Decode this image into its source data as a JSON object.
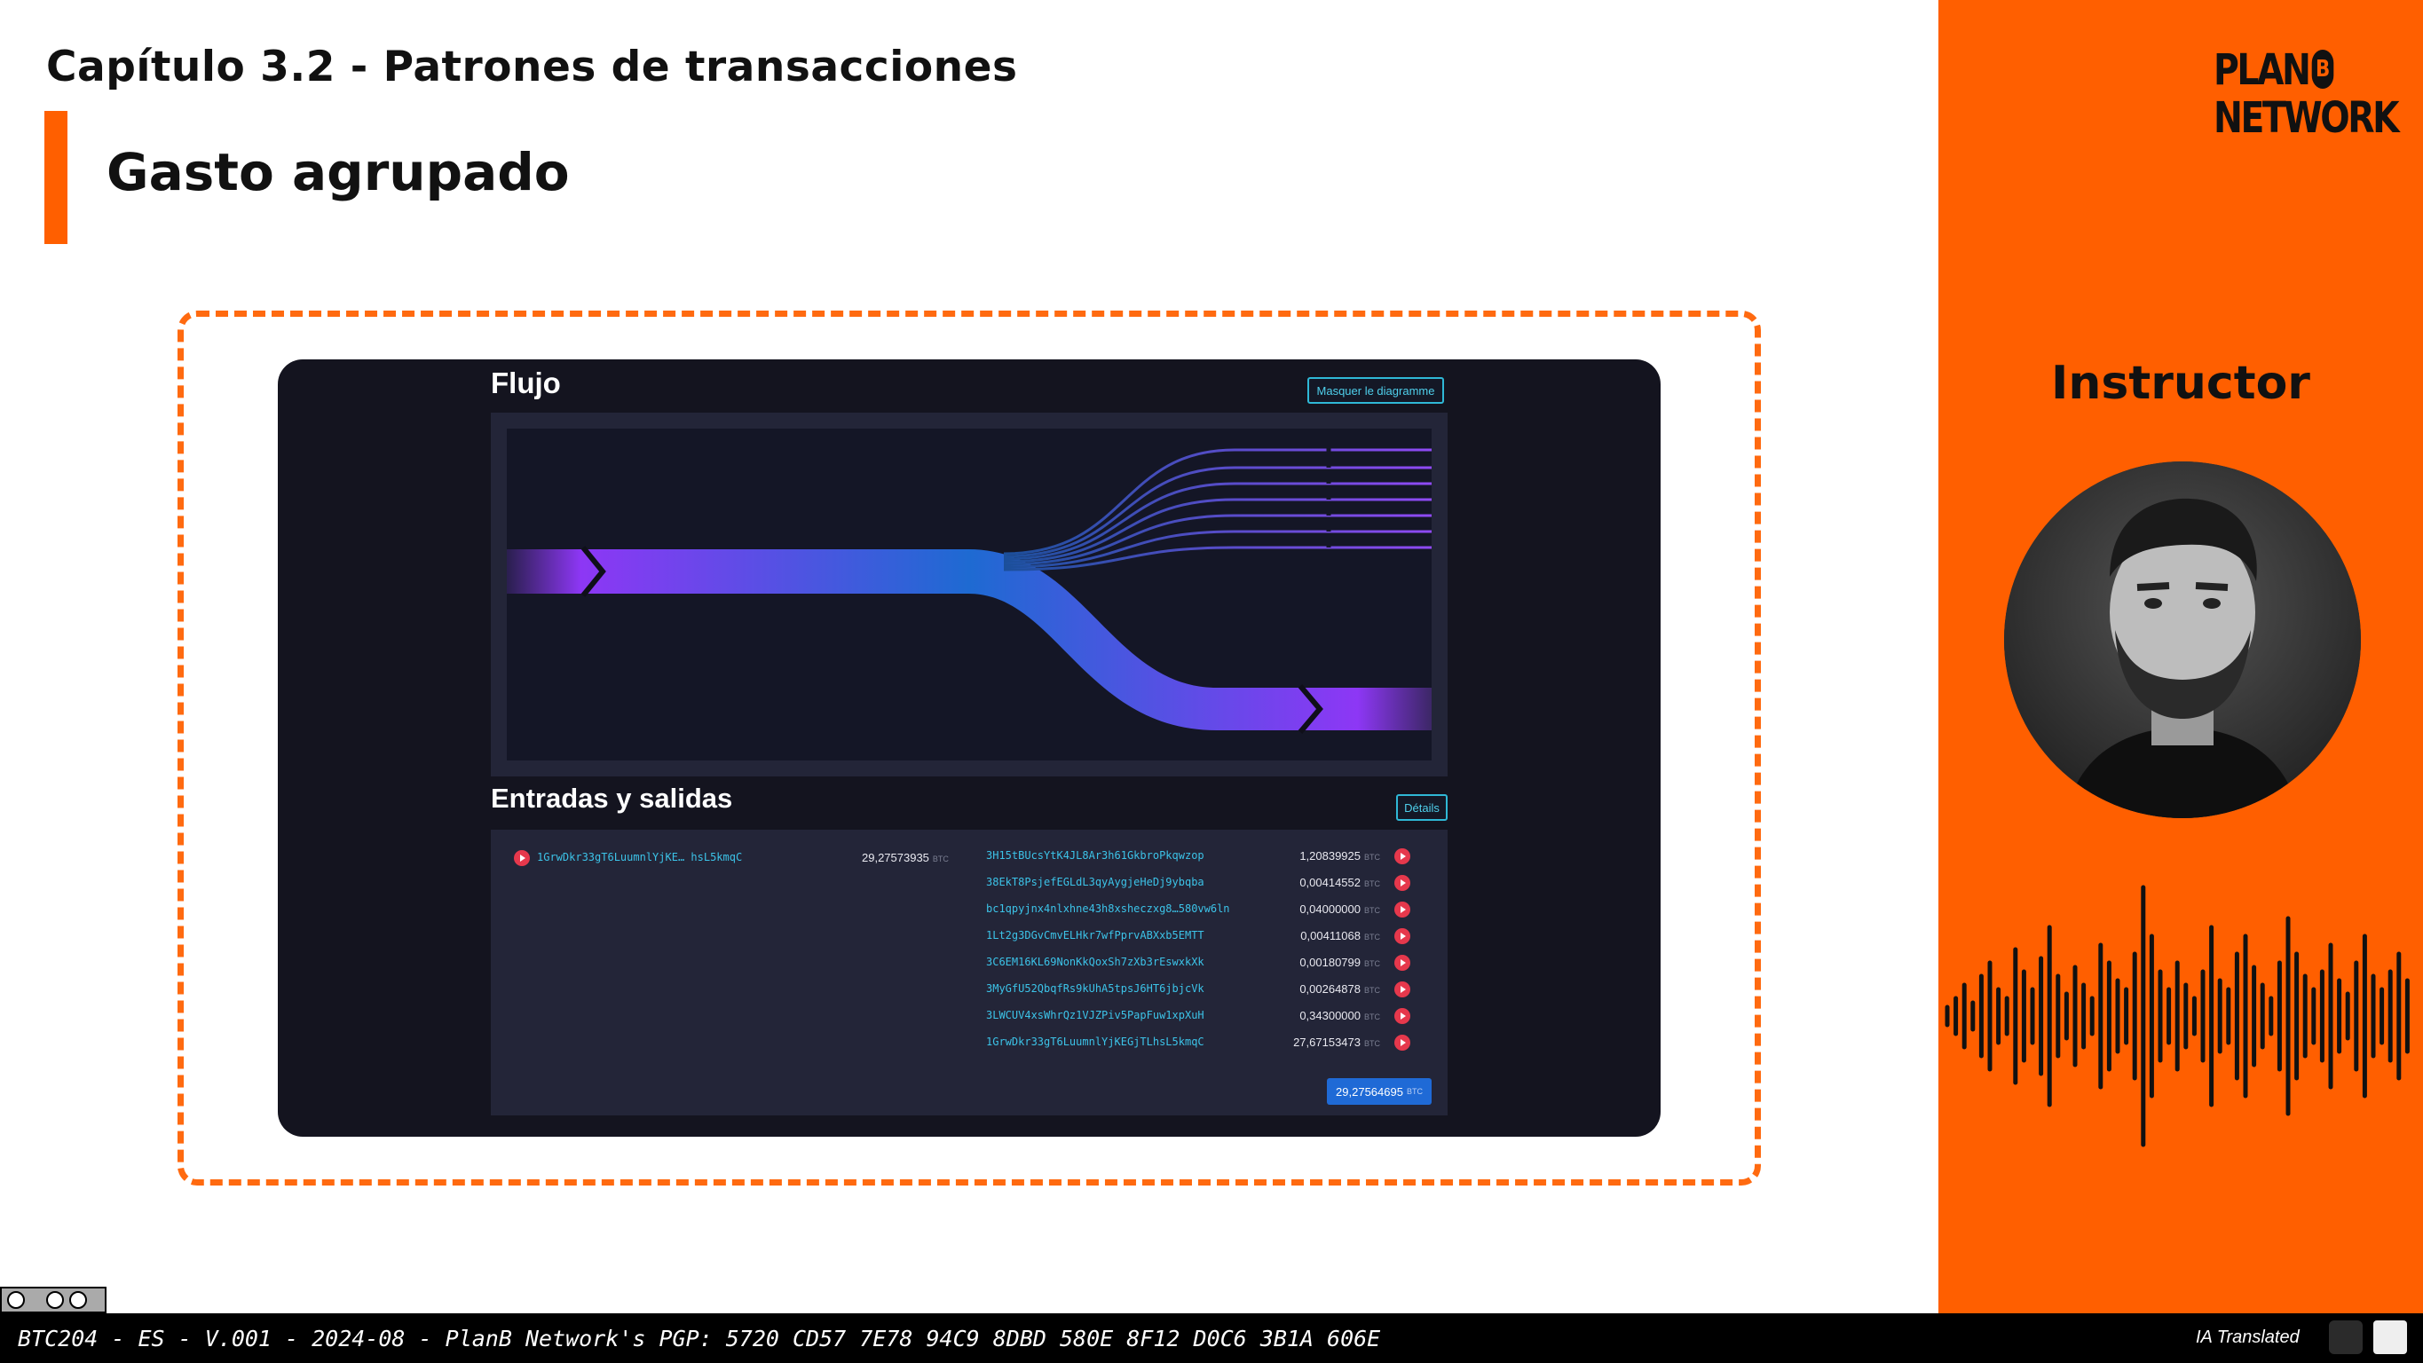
{
  "slide": {
    "chapter": "Capítulo 3.2 - Patrones de transacciones",
    "section": "Gasto agrupado"
  },
  "sidebar": {
    "logo_line1": "PLAN",
    "logo_b": "B",
    "logo_line2": "NETWORK",
    "instructor_label": "Instructor"
  },
  "flow": {
    "title": "Flujo",
    "hide_button": "Masquer le diagramme",
    "gradient": [
      "#9b3bff",
      "#1a6fd4"
    ]
  },
  "io": {
    "title": "Entradas y salidas",
    "details_button": "Détails",
    "unit": "BTC",
    "inputs": [
      {
        "address": "1GrwDkr33gT6LuumnlYjKE… hsL5kmqC",
        "amount": "29,27573935"
      }
    ],
    "outputs": [
      {
        "address": "3H15tBUcsYtK4JL8Ar3h61GkbroPkqwzop",
        "amount": "1,20839925"
      },
      {
        "address": "38EkT8PsjefEGLdL3qyAygjeHeDj9ybqba",
        "amount": "0,00414552"
      },
      {
        "address": "bc1qpyjnx4nlxhne43h8xsheczxg8…580vw6ln",
        "amount": "0,04000000"
      },
      {
        "address": "1Lt2g3DGvCmvELHkr7wfPprvABXxb5EMTT",
        "amount": "0,00411068"
      },
      {
        "address": "3C6EM16KL69NonKkQoxSh7zXb3rEswxkXk",
        "amount": "0,00180799"
      },
      {
        "address": "3MyGfU52QbqfRs9kUhA5tpsJ6HT6jbjcVk",
        "amount": "0,00264878"
      },
      {
        "address": "3LWCUV4xsWhrQz1VJZPiv5PapFuw1xpXuH",
        "amount": "0,34300000"
      },
      {
        "address": "1GrwDkr33gT6LuumnlYjKEGjTLhsL5kmqC",
        "amount": "27,67153473"
      }
    ],
    "total": "29,27564695"
  },
  "footer": {
    "text": "BTC204 - ES - V.001 - 2024-08 - PlanB Network's PGP: 5720 CD57 7E78 94C9 8DBD 580E 8F12 D0C6 3B1A 606E",
    "ia_label": "IA Translated"
  },
  "colors": {
    "accent": "#ff5f00",
    "link": "#3cc3e8",
    "danger": "#e6384c",
    "primary": "#1f6ad6"
  },
  "icons": [
    "creative-commons-icon",
    "arrow-right-circle-icon",
    "openai-icon",
    "translator-logo-icon",
    "audio-waveform-icon"
  ]
}
